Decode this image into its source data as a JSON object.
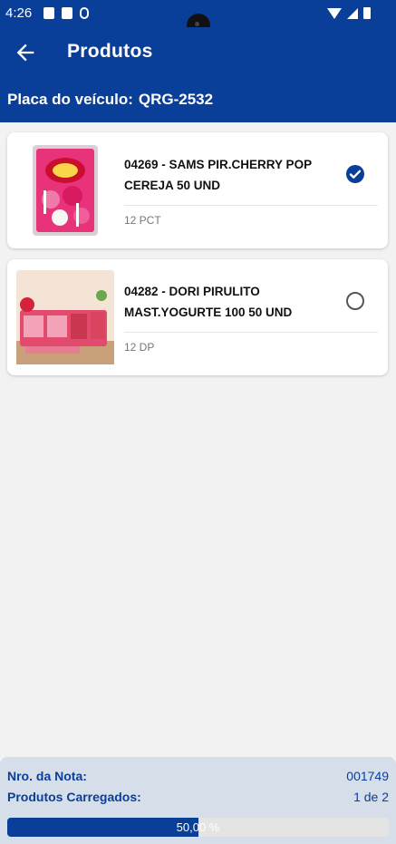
{
  "status_bar": {
    "time": "4:26"
  },
  "header": {
    "title": "Produtos",
    "plate_label": "Placa do veículo:",
    "plate_value": "QRG-2532"
  },
  "products": [
    {
      "name": "04269 - SAMS PIR.CHERRY POP CEREJA 50 UND",
      "unit": "12 PCT",
      "checked": true,
      "icon": "checkmark-circle-icon"
    },
    {
      "name": "04282 - DORI PIRULITO MAST.YOGURTE 100 50 UND",
      "unit": "12 DP",
      "checked": false,
      "icon": "radio-empty-icon"
    }
  ],
  "footer": {
    "nota_label": "Nro. da Nota:",
    "nota_value": "001749",
    "loaded_label": "Produtos Carregados:",
    "loaded_value": "1 de 2",
    "progress_text": "50,00 %",
    "progress_fraction": 0.5
  },
  "colors": {
    "primary": "#0a3f99",
    "background": "#f2f2f2",
    "footer": "#d6dee9"
  }
}
